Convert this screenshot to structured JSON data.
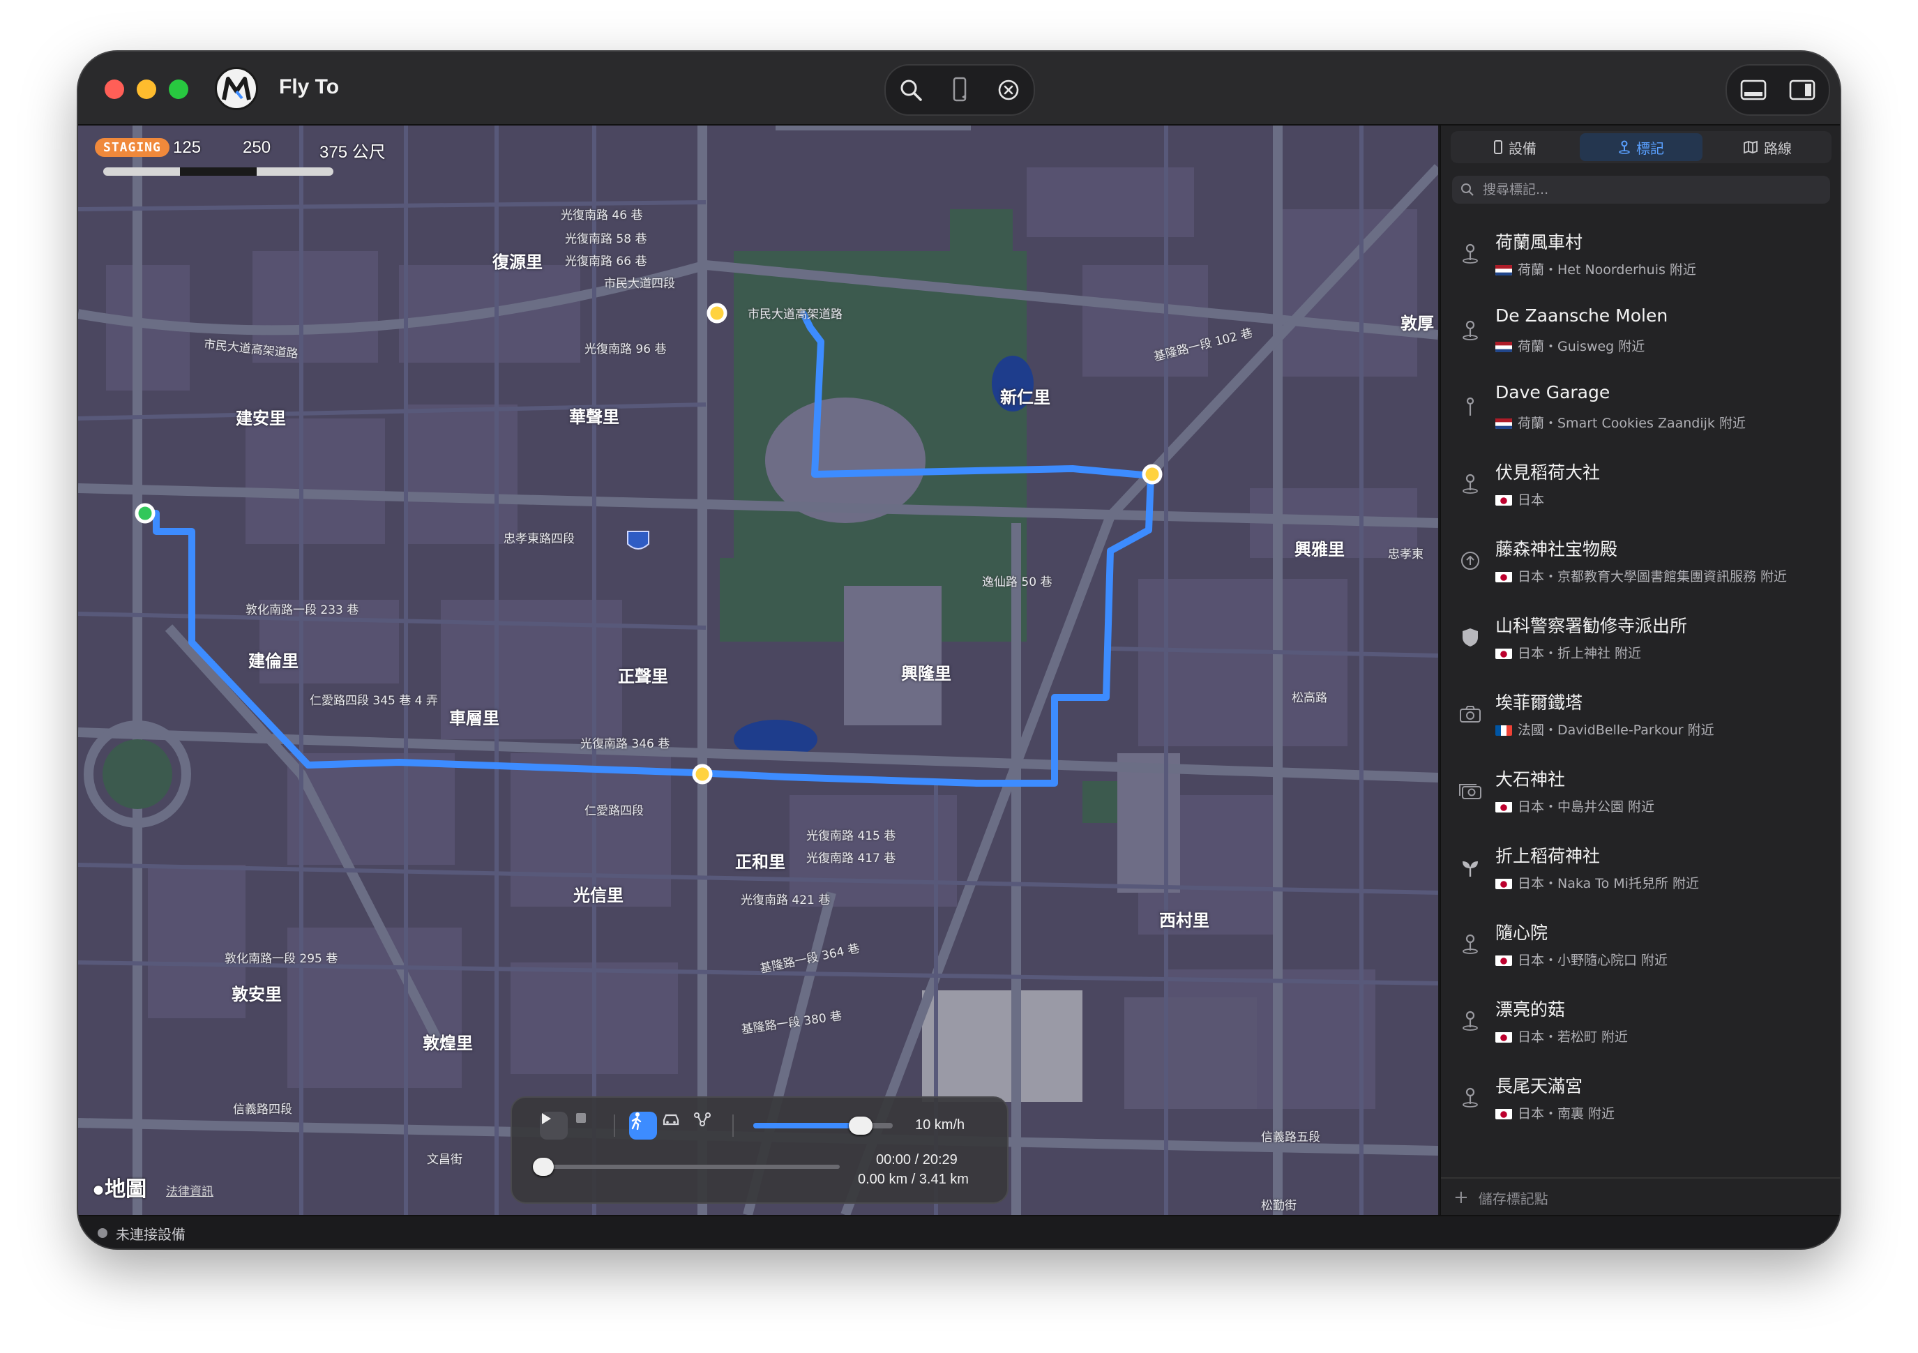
{
  "app": {
    "title": "Fly To"
  },
  "colors": {
    "route": "#3d8cff",
    "waypoint": "#ffd23f",
    "start": "#32c75a",
    "map_block": "#4b4760",
    "map_road": "#6b6e85",
    "accent": "#5aa0ff",
    "staging": "#f0893b"
  },
  "toolbar": {
    "icons": [
      "search-icon",
      "phone-location-icon",
      "close-circle-icon",
      "panel-bottom-icon",
      "sidebar-right-icon"
    ]
  },
  "map": {
    "badge": "STAGING",
    "scale": [
      "125",
      "250",
      "375 公尺"
    ],
    "attribution": "地圖",
    "legal": "法律資訊",
    "district_labels": [
      "復源里",
      "新仁里",
      "建安里",
      "華聲里",
      "建倫里",
      "正聲里",
      "興隆里",
      "車層里",
      "正和里",
      "光信里",
      "西村里",
      "敦安里",
      "敦煌里",
      "興雅里",
      "敦厚"
    ],
    "road_labels": [
      "市民大道高架道路",
      "市民大道高架道路",
      "忠孝東路四段",
      "仁愛路四段",
      "敦化南路一段 233 巷",
      "仁愛路四段 345 巷 4 弄",
      "光復南路 346 巷",
      "逸仙路 50 巷",
      "光復南路 415 巷",
      "光復南路 417 巷",
      "光復南路 421 巷",
      "基隆路一段 364 巷",
      "基隆路一段 380 巷",
      "敦化南路一段 295 巷",
      "信義路四段",
      "信義路五段",
      "基隆路一段 102 巷",
      "忠孝東",
      "松高路",
      "松勤街",
      "文昌街",
      "光復南路 46 巷",
      "光復南路 58 巷",
      "光復南路 66 巷",
      "市民大道四段",
      "光復南路 96 巷"
    ]
  },
  "playback": {
    "modes": [
      "walk-icon",
      "car-icon",
      "route-icon"
    ],
    "speed": "10 km/h",
    "speed_fraction": 0.77,
    "time": "00:00 / 20:29",
    "distance": "0.00 km / 3.41 km",
    "progress_fraction": 0.0
  },
  "sidebar": {
    "tabs": [
      {
        "label": "設備",
        "icon": "device-icon"
      },
      {
        "label": "標記",
        "icon": "pin-icon",
        "active": true
      },
      {
        "label": "路線",
        "icon": "map-icon"
      }
    ],
    "search_placeholder": "搜尋標記...",
    "items": [
      {
        "title": "荷蘭風車村",
        "sub": "荷蘭・Het Noorderhuis 附近",
        "flag": "nl",
        "icon": "pin-icon"
      },
      {
        "title": "De Zaansche Molen",
        "sub": "荷蘭・Guisweg 附近",
        "flag": "nl",
        "icon": "pin-icon"
      },
      {
        "title": "Dave Garage",
        "sub": "荷蘭・Smart Cookies Zaandijk 附近",
        "flag": "nl",
        "icon": "map-pin-icon"
      },
      {
        "title": "伏見稻荷大社",
        "sub": "日本",
        "flag": "jp",
        "icon": "pin-icon"
      },
      {
        "title": "藤森神社宝物殿",
        "sub": "日本・京都教育大學圖書館集團資訊服務 附近",
        "flag": "jp",
        "icon": "upload-circle-icon"
      },
      {
        "title": "山科警察署勧修寺派出所",
        "sub": "日本・折上神社 附近",
        "flag": "jp",
        "icon": "shield-icon"
      },
      {
        "title": "埃菲爾鐵塔",
        "sub": "法國・DavidBelle-Parkour 附近",
        "flag": "fr",
        "icon": "camera-icon"
      },
      {
        "title": "大石神社",
        "sub": "日本・中島井公園 附近",
        "flag": "jp",
        "icon": "camera-stack-icon"
      },
      {
        "title": "折上稻荷神社",
        "sub": "日本・Naka To Mi托兒所 附近",
        "flag": "jp",
        "icon": "plant-icon"
      },
      {
        "title": "隨心院",
        "sub": "日本・小野隨心院口 附近",
        "flag": "jp",
        "icon": "pin-icon"
      },
      {
        "title": "漂亮的菇",
        "sub": "日本・若松町 附近",
        "flag": "jp",
        "icon": "pin-icon"
      },
      {
        "title": "長尾天滿宮",
        "sub": "日本・南裏 附近",
        "flag": "jp",
        "icon": "pin-icon"
      }
    ],
    "save_label": "儲存標記點"
  },
  "status": {
    "text": "未連接設備"
  }
}
